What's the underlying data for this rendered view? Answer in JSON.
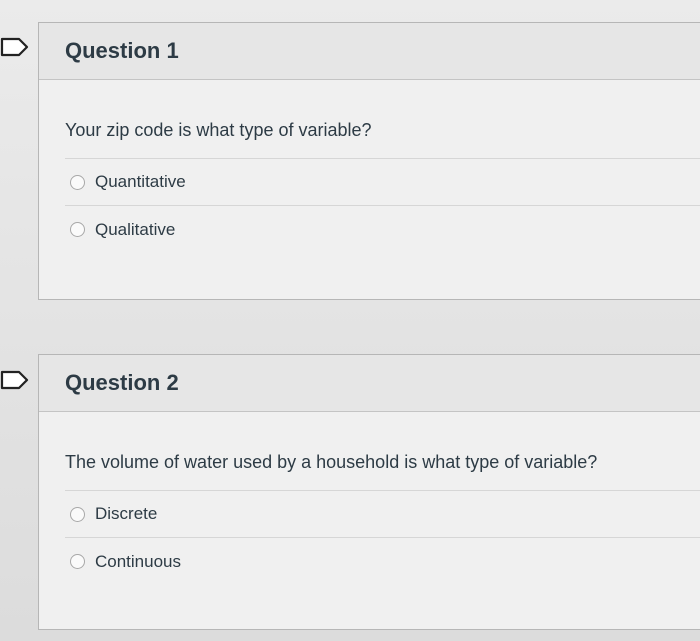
{
  "questions": [
    {
      "title": "Question 1",
      "text": "Your zip code is what type of variable?",
      "answers": [
        "Quantitative",
        "Qualitative"
      ]
    },
    {
      "title": "Question 2",
      "text": "The volume of water used by a household is what type of variable?",
      "answers": [
        "Discrete",
        "Continuous"
      ]
    }
  ],
  "colors": {
    "text": "#2d3b45",
    "flag_stroke": "#222222"
  },
  "icons": {
    "flag": "flag-question-icon",
    "radio": "radio-unselected-icon"
  }
}
